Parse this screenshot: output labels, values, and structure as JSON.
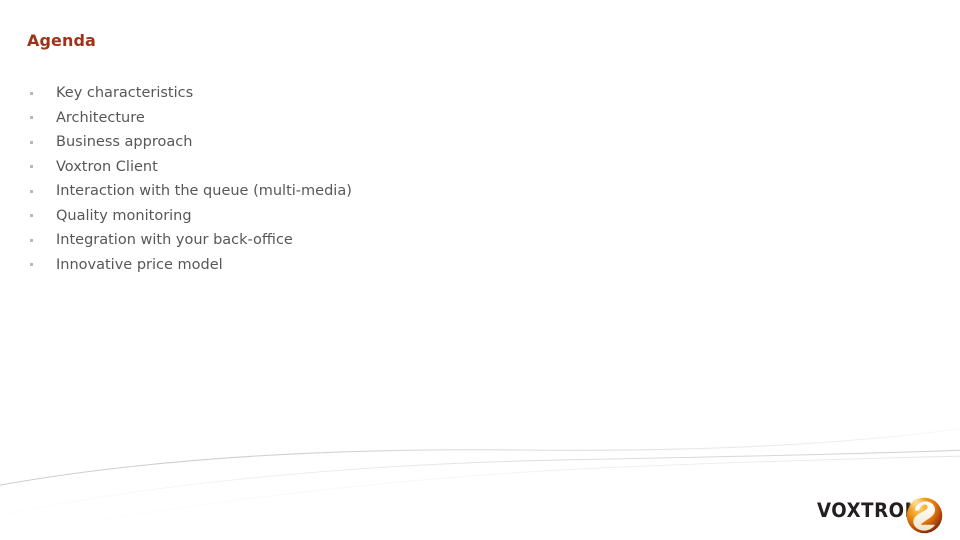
{
  "slide": {
    "title": "Agenda",
    "title_color": "#9e3318",
    "background_color": "#ffffff",
    "body_text_color": "#575757",
    "bullet_color": "#b9b9b9"
  },
  "agenda": {
    "items": [
      {
        "label": "Key characteristics"
      },
      {
        "label": "Architecture"
      },
      {
        "label": "Business approach"
      },
      {
        "label": "Voxtron Client"
      },
      {
        "label": "Interaction with the queue (multi-media)"
      },
      {
        "label": "Quality monitoring"
      },
      {
        "label": "Integration with your back-office"
      },
      {
        "label": "Innovative price model"
      }
    ]
  },
  "logo": {
    "wordmark": "VOXTRON",
    "wordmark_color": "#231f20",
    "mark_name": "voxtron-sphere-icon",
    "mark_colors": {
      "rim": "#7d2b0c",
      "orange": "#ef8315",
      "gold": "#f6ba3d",
      "deep": "#a33c08",
      "swirl": "#fdf6ec"
    }
  },
  "decoration": {
    "wave_name": "bottom-swoosh",
    "wave_color": "#d8d8da"
  }
}
